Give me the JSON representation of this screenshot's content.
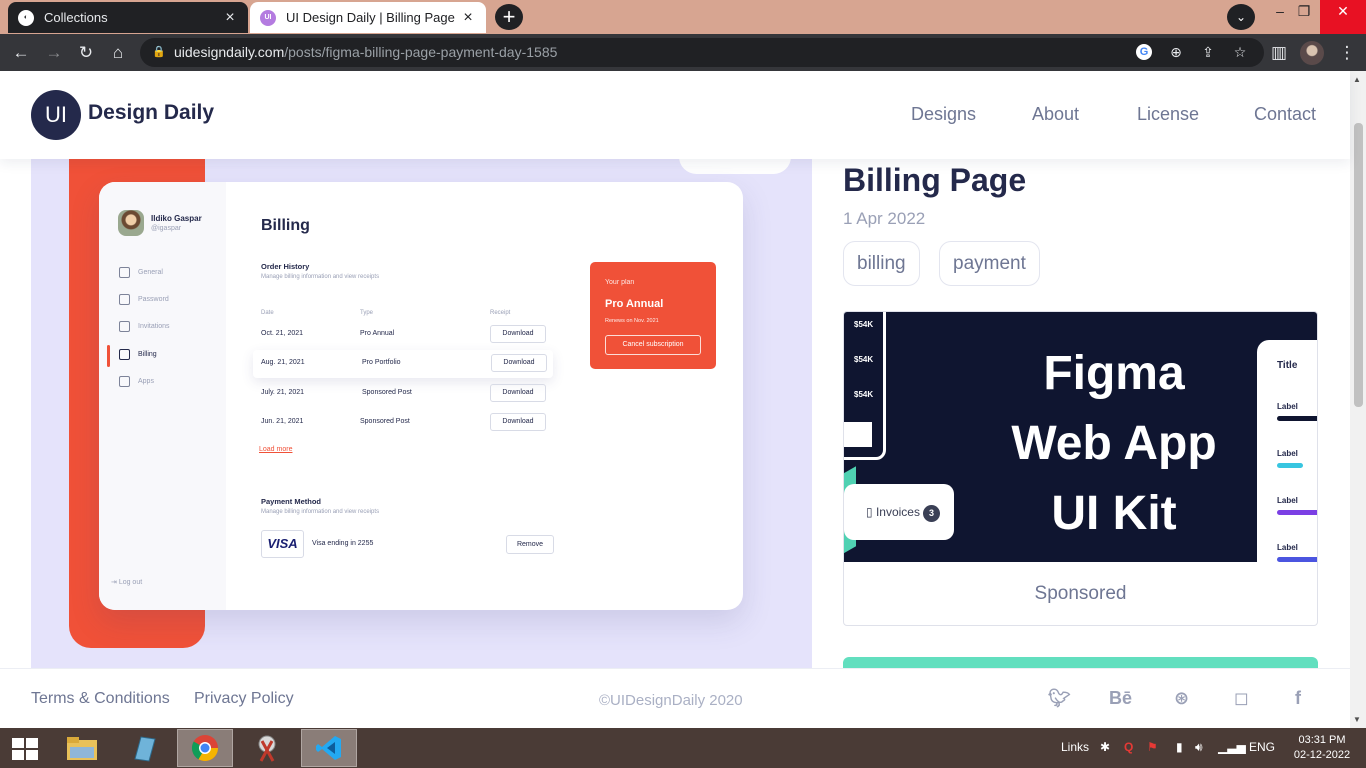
{
  "browser": {
    "tabs": [
      {
        "title": "Collections",
        "favicon_text": ""
      },
      {
        "title": "UI Design Daily | Billing Page",
        "favicon_text": "UI"
      }
    ],
    "url_host": "uidesigndaily.com",
    "url_path": "/posts/figma-billing-page-payment-day-1585"
  },
  "site": {
    "logo_text": "UI",
    "brand": "Design Daily",
    "nav": [
      "Designs",
      "About",
      "License",
      "Contact"
    ]
  },
  "preview": {
    "user_name": "Ildiko Gaspar",
    "user_handle": "@igaspar",
    "menu": [
      "General",
      "Password",
      "Invitations",
      "Billing",
      "Apps"
    ],
    "logout": "Log out",
    "title": "Billing",
    "order_history": {
      "heading": "Order History",
      "sub": "Manage billing information and view receipts",
      "columns": [
        "Date",
        "Type",
        "Receipt"
      ],
      "rows": [
        {
          "date": "Oct. 21, 2021",
          "type": "Pro Annual",
          "action": "Download"
        },
        {
          "date": "Aug. 21, 2021",
          "type": "Pro Portfolio",
          "action": "Download"
        },
        {
          "date": "July. 21, 2021",
          "type": "Sponsored Post",
          "action": "Download"
        },
        {
          "date": "Jun. 21, 2021",
          "type": "Sponsored Post",
          "action": "Download"
        }
      ],
      "load_more": "Load more"
    },
    "plan": {
      "label": "Your plan",
      "name": "Pro Annual",
      "renews": "Renews on  Nov. 2021",
      "cancel": "Cancel subscription"
    },
    "payment": {
      "heading": "Payment Method",
      "sub": "Manage billing information and view receipts",
      "card_brand": "VISA",
      "card_text": "Visa ending in 2255",
      "remove": "Remove"
    }
  },
  "post": {
    "title": "Billing Page",
    "date": "1 Apr 2022",
    "tags": [
      "billing",
      "payment"
    ]
  },
  "ad": {
    "side_labels": [
      "$54K",
      "$54K",
      "$54K"
    ],
    "invoices_label": "Invoices",
    "invoices_count": "3",
    "headline_lines": [
      "Figma",
      "Web App",
      "UI Kit"
    ],
    "panel_title": "Title",
    "panel_labels": [
      "Label",
      "Label",
      "Label",
      "Label"
    ],
    "caption": "Sponsored"
  },
  "footer": {
    "links": [
      "Terms & Conditions",
      "Privacy Policy"
    ],
    "copyright": "©UIDesignDaily 2020",
    "social_icons": [
      "twitter-icon",
      "behance-icon",
      "dribbble-icon",
      "instagram-icon",
      "facebook-icon"
    ]
  },
  "taskbar": {
    "links_label": "Links",
    "lang": "ENG",
    "time": "03:31 PM",
    "date": "02-12-2022"
  },
  "colors": {
    "accent_red": "#f05138",
    "navy": "#24294b",
    "teal": "#62dfbf"
  }
}
